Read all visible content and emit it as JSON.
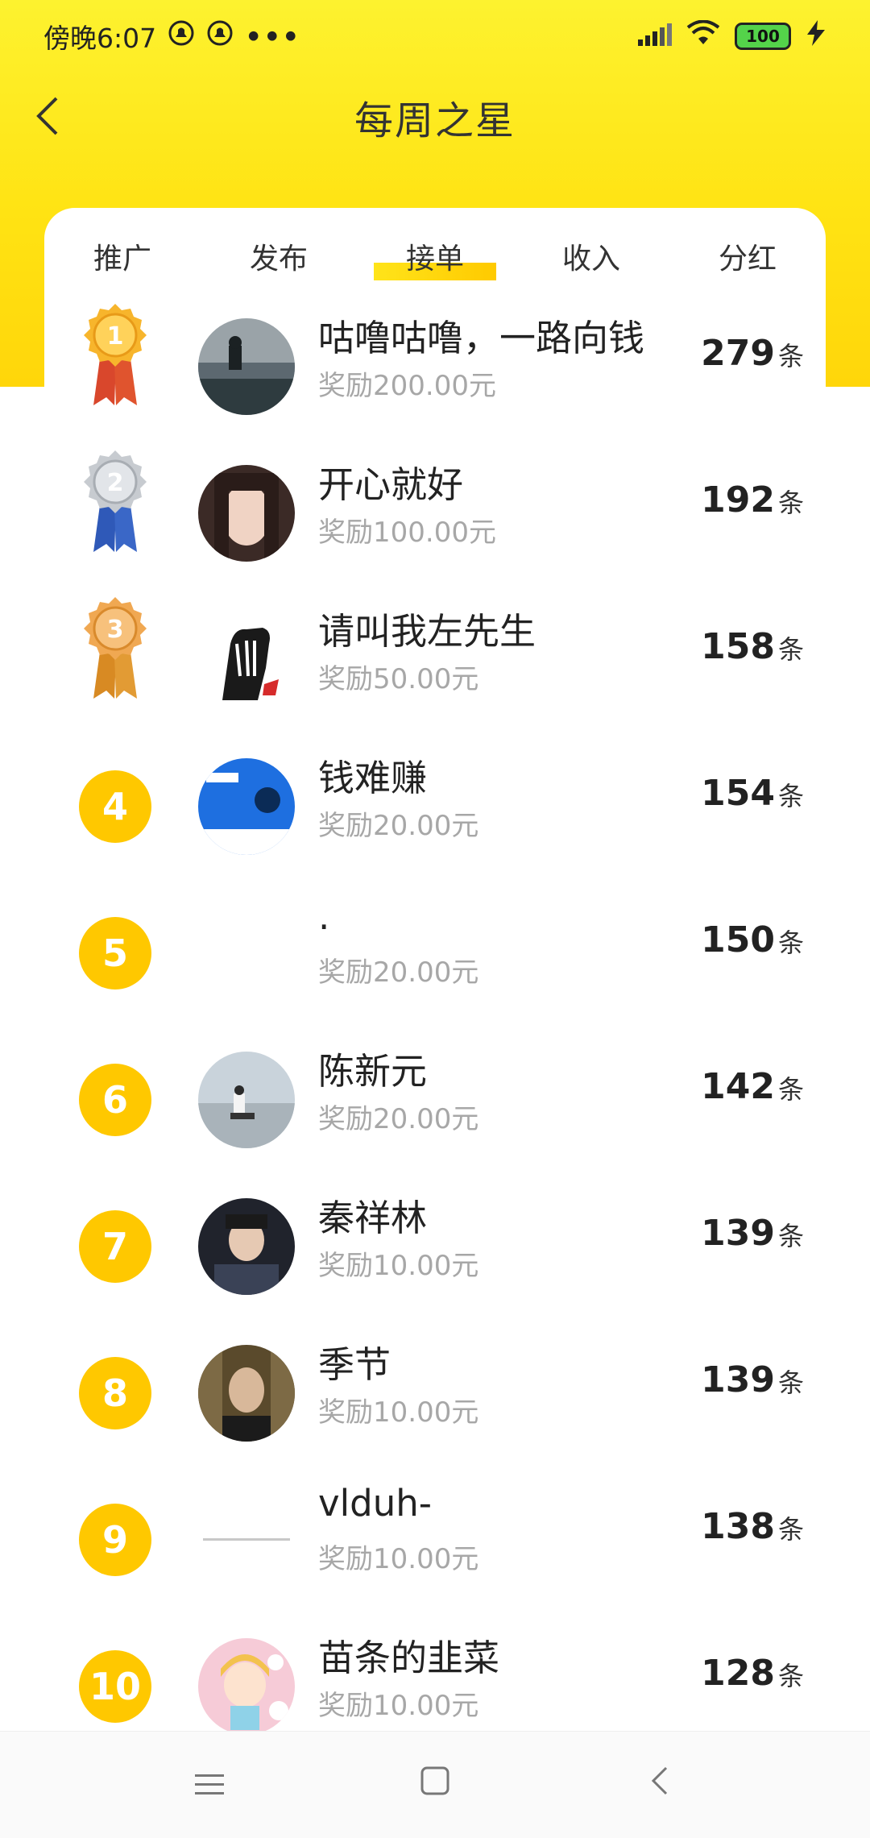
{
  "status_bar": {
    "time": "傍晚6:07",
    "icons_left": [
      "notification-icon",
      "notification-icon",
      "more-icon"
    ],
    "icons_right": [
      "signal-icon",
      "wifi-icon",
      "battery-icon",
      "charging-icon"
    ],
    "battery": "100"
  },
  "header": {
    "title": "每周之星",
    "back_icon": "chevron-left-icon"
  },
  "tabs": [
    {
      "label": "推广",
      "active": false
    },
    {
      "label": "发布",
      "active": false
    },
    {
      "label": "接单",
      "active": true
    },
    {
      "label": "收入",
      "active": false
    },
    {
      "label": "分红",
      "active": false
    }
  ],
  "rankings": [
    {
      "rank": "1",
      "name": "咕噜咕噜，一路向钱",
      "reward": "奖励200.00元",
      "count": "279",
      "unit": "条",
      "badge": "gold-medal-icon"
    },
    {
      "rank": "2",
      "name": "开心就好",
      "reward": "奖励100.00元",
      "count": "192",
      "unit": "条",
      "badge": "silver-medal-icon"
    },
    {
      "rank": "3",
      "name": "请叫我左先生",
      "reward": "奖励50.00元",
      "count": "158",
      "unit": "条",
      "badge": "bronze-medal-icon"
    },
    {
      "rank": "4",
      "name": "钱难赚",
      "reward": "奖励20.00元",
      "count": "154",
      "unit": "条"
    },
    {
      "rank": "5",
      "name": ".",
      "reward": "奖励20.00元",
      "count": "150",
      "unit": "条"
    },
    {
      "rank": "6",
      "name": "陈新元",
      "reward": "奖励20.00元",
      "count": "142",
      "unit": "条"
    },
    {
      "rank": "7",
      "name": "秦祥林",
      "reward": "奖励10.00元",
      "count": "139",
      "unit": "条"
    },
    {
      "rank": "8",
      "name": "季节",
      "reward": "奖励10.00元",
      "count": "139",
      "unit": "条"
    },
    {
      "rank": "9",
      "name": "vlduh-",
      "reward": "奖励10.00元",
      "count": "138",
      "unit": "条"
    },
    {
      "rank": "10",
      "name": "苗条的韭菜",
      "reward": "奖励10.00元",
      "count": "128",
      "unit": "条"
    }
  ],
  "colors": {
    "header_yellow": "#ffe313",
    "rank_circle": "#ffc800",
    "reward_gray": "#a7a7a7"
  },
  "nav": {
    "items": [
      "menu-icon",
      "home-icon",
      "back-icon"
    ]
  }
}
